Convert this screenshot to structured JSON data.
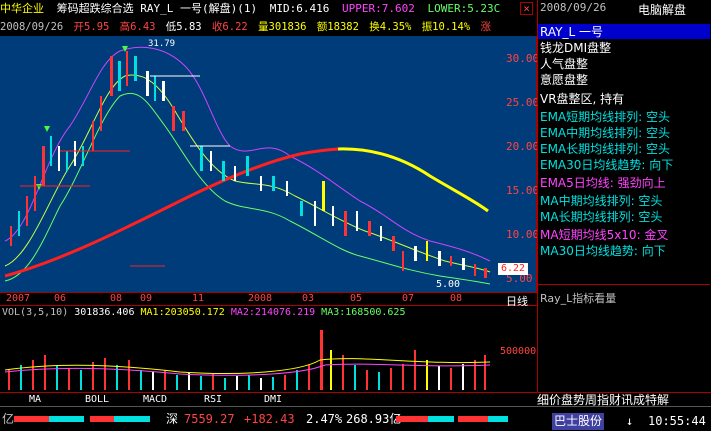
{
  "header": {
    "stock_name": "中华企业",
    "indicator_title": "筹码超跌综合选 RAY_L 一号(解盘)(1)",
    "mid": "MID:6.416",
    "upper": "UPPER:7.602",
    "lower": "LOWER:5.23C",
    "close_icon": "×"
  },
  "quote": {
    "date": "2008/09/26",
    "open": "开5.95",
    "high": "高6.43",
    "low": "低5.83",
    "close": "收6.22",
    "volume": "量301836",
    "amount": "额18382",
    "turnover": "换4.35%",
    "amplitude": "振10.14%",
    "change": "涨"
  },
  "price_axis": [
    "30.00",
    "25.00",
    "20.00",
    "15.00",
    "10.00",
    "5.00"
  ],
  "price_tags": {
    "current": "6.22",
    "bottom": "5.00",
    "peak": "31.79"
  },
  "date_axis": [
    "2007",
    "06",
    "08",
    "09",
    "11",
    "2008",
    "03",
    "05",
    "07",
    "08"
  ],
  "date_axis_label": "日线",
  "volume_panel": {
    "title": "VOL(3,5,10)",
    "vol": "301836.406",
    "ma1": "MA1:203050.172",
    "ma2": "MA2:214076.219",
    "ma3": "MA3:168500.625",
    "axis_value": "500000"
  },
  "tabs": [
    "MA",
    "BOLL",
    "MACD",
    "RSI",
    "DMI"
  ],
  "right_panel": {
    "date": "2008/09/26",
    "title": "电脑解盘",
    "items": [
      {
        "text": "RAY_L 一号",
        "color": "#ffffff",
        "highlight": true
      },
      {
        "text": "钱龙DMI盘整",
        "color": "#ffffff"
      },
      {
        "text": "人气盘整",
        "color": "#ffffff"
      },
      {
        "text": "意愿盘整",
        "color": "#ffffff"
      },
      {
        "text": "VR盘整区, 持有",
        "color": "#ffffff"
      },
      {
        "text": "EMA短期均线排列: 空头",
        "color": "#00e0e0"
      },
      {
        "text": "EMA中期均线排列: 空头",
        "color": "#00e0e0"
      },
      {
        "text": "EMA长期均线排列: 空头",
        "color": "#00e0e0"
      },
      {
        "text": "EMA30日均线趋势: 向下",
        "color": "#00e0e0"
      },
      {
        "text": "EMA5日均线: 强劲向上",
        "color": "#ff44ff"
      },
      {
        "text": "MA中期均线排列: 空头",
        "color": "#00e0e0"
      },
      {
        "text": "MA长期均线排列: 空头",
        "color": "#00e0e0"
      },
      {
        "text": "MA短期均线5x10: 金叉",
        "color": "#ff44ff"
      },
      {
        "text": "MA30日均线趋势: 向下",
        "color": "#00e0e0"
      }
    ],
    "footer": "Ray_L指标看量"
  },
  "status_bar": {
    "left_tail": "亿",
    "index_name": "深",
    "index_value": "7559.27",
    "index_change": "+182.43",
    "index_pct": "2.47%",
    "index_amount": "268.93亿",
    "menu": "细价盘势周指财讯成特解",
    "broker": "巴士股份",
    "arrow": "↓",
    "time": "10:55:44"
  },
  "colors": {
    "chart_bg": "#003c7a",
    "up": "#ff3333",
    "down": "#00e0e0",
    "ma_red": "#ff2020",
    "ma_yellow": "#ffff00",
    "magenta": "#cc44ff",
    "green": "#66ff66"
  }
}
